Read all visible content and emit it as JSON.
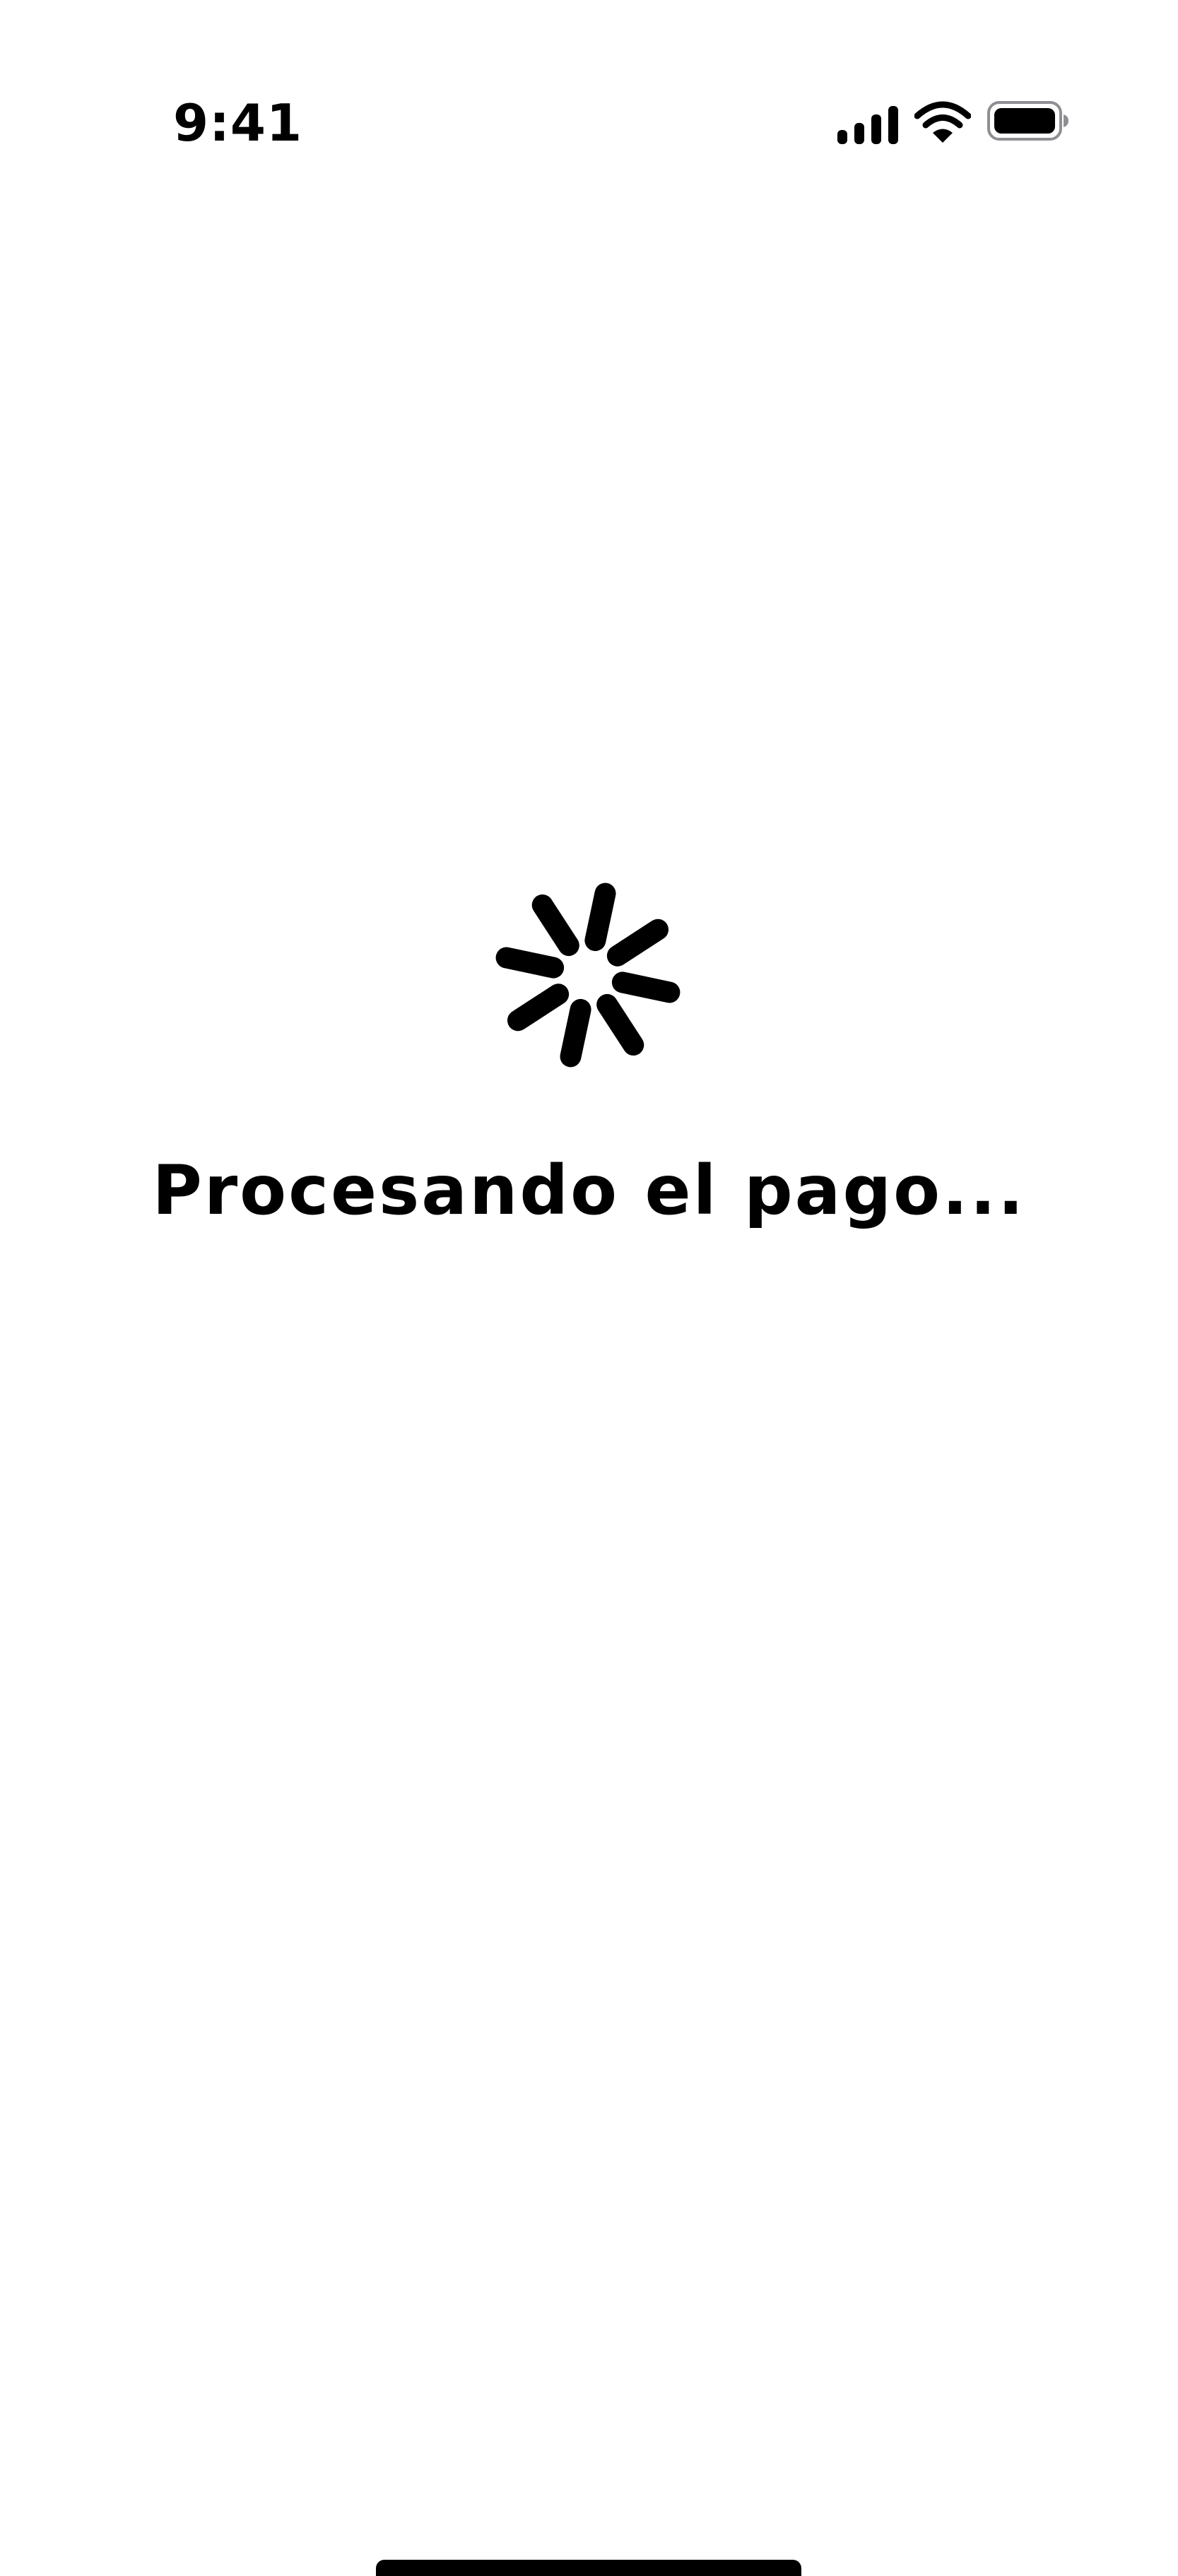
{
  "status_bar": {
    "time": "9:41",
    "icons": [
      "cellular-signal-icon",
      "wifi-icon",
      "battery-icon"
    ]
  },
  "loader": {
    "icon": "activity-spinner-icon",
    "title": "Procesando el pago..."
  },
  "colors": {
    "background": "#ffffff",
    "foreground": "#000000"
  }
}
